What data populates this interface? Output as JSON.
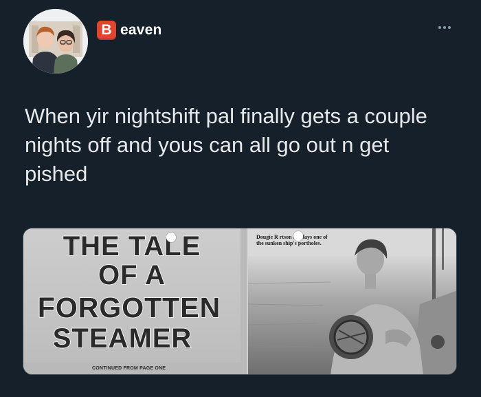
{
  "author": {
    "badge_letter": "B",
    "name": "eaven",
    "badge_color": "#e0452f"
  },
  "tweet": {
    "text": "When yir nightshift pal finally gets a couple nights off and yous can all go out n get pished"
  },
  "media": {
    "headline_lines": [
      "THE TALE",
      "OF A",
      "FORGOTTEN",
      "STEAMER"
    ],
    "continued": "CONTINUED FROM PAGE ONE",
    "caption": "Dougie R  rtson displays one of the sunken ship's portholes."
  },
  "icons": {
    "more": "more-horizontal-icon"
  },
  "colors": {
    "background": "#15202b",
    "text": "#e7e9ea",
    "muted": "#8b98a5"
  }
}
